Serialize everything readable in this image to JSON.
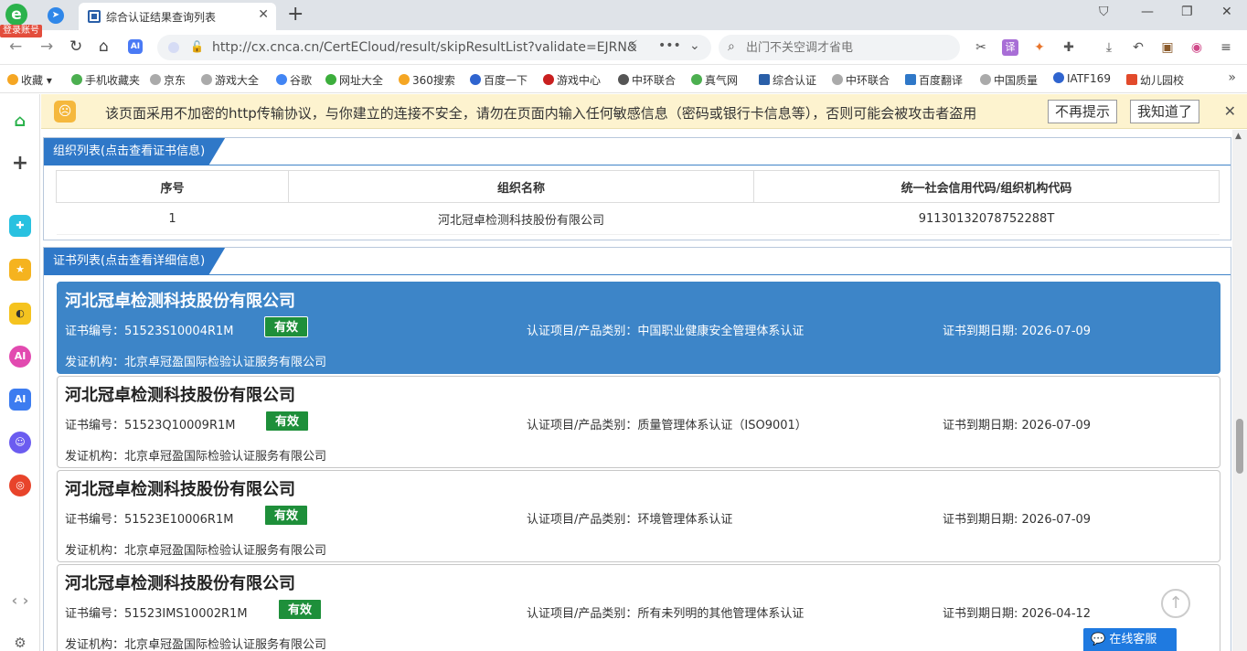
{
  "browser": {
    "login_badge": "登录账号",
    "tab_title": "综合认证结果查询列表",
    "url": "http://cx.cnca.cn/CertECloud/result/skipResultList?validate=EJRN&",
    "search_placeholder": "出门不关空调才省电"
  },
  "bookmarks": [
    {
      "label": "收藏",
      "color": "#f5a623"
    },
    {
      "label": "手机收藏夹",
      "color": "#4caf50"
    },
    {
      "label": "京东",
      "color": "#999999"
    },
    {
      "label": "游戏大全",
      "color": "#999999"
    },
    {
      "label": "谷歌",
      "color": "#4285f4"
    },
    {
      "label": "网址大全",
      "color": "#3cae3c"
    },
    {
      "label": "360搜索",
      "color": "#f5a623"
    },
    {
      "label": "百度一下",
      "color": "#2f64cf"
    },
    {
      "label": "游戏中心",
      "color": "#c91f1f"
    },
    {
      "label": "中环联合",
      "color": "#555555"
    },
    {
      "label": "真气网",
      "color": "#4caf50"
    },
    {
      "label": "综合认证",
      "color": "#2a5fa8"
    },
    {
      "label": "中环联合",
      "color": "#999999"
    },
    {
      "label": "百度翻译",
      "color": "#2f78c8"
    },
    {
      "label": "中国质量",
      "color": "#999999"
    },
    {
      "label": "IATF169",
      "color": "#2f64cf"
    },
    {
      "label": "幼儿园校",
      "color": "#e24a2b"
    }
  ],
  "warning": {
    "text": "该页面采用不加密的http传输协议，与你建立的连接不安全，请勿在页面内输入任何敏感信息（密码或银行卡信息等），否则可能会被攻击者盗用",
    "dismiss_label": "不再提示",
    "ok_label": "我知道了"
  },
  "org_panel": {
    "title": "组织列表(点击查看证书信息)",
    "headers": [
      "序号",
      "组织名称",
      "统一社会信用代码/组织机构代码"
    ],
    "rows": [
      {
        "no": "1",
        "name": "河北冠卓检测科技股份有限公司",
        "code": "91130132078752288T"
      }
    ]
  },
  "cert_panel": {
    "title": "证书列表(点击查看详细信息)",
    "certs": [
      {
        "org": "河北冠卓检测科技股份有限公司",
        "cert_no": "证书编号：51523S10004R1M",
        "status": "有效",
        "project": "认证项目/产品类别：中国职业健康安全管理体系认证",
        "expiry": "证书到期日期: 2026-07-09",
        "issuer": "发证机构：北京卓冠盈国际检验认证服务有限公司"
      },
      {
        "org": "河北冠卓检测科技股份有限公司",
        "cert_no": "证书编号：51523Q10009R1M",
        "status": "有效",
        "project": "认证项目/产品类别：质量管理体系认证（ISO9001）",
        "expiry": "证书到期日期: 2026-07-09",
        "issuer": "发证机构：北京卓冠盈国际检验认证服务有限公司"
      },
      {
        "org": "河北冠卓检测科技股份有限公司",
        "cert_no": "证书编号：51523E10006R1M",
        "status": "有效",
        "project": "认证项目/产品类别：环境管理体系认证",
        "expiry": "证书到期日期: 2026-07-09",
        "issuer": "发证机构：北京卓冠盈国际检验认证服务有限公司"
      },
      {
        "org": "河北冠卓检测科技股份有限公司",
        "cert_no": "证书编号：51523IMS10002R1M",
        "status": "有效",
        "project": "认证项目/产品类别：所有未列明的其他管理体系认证",
        "expiry": "证书到期日期: 2026-04-12",
        "issuer": "发证机构：北京卓冠盈国际检验认证服务有限公司"
      }
    ]
  },
  "service_label": "在线客服",
  "colors": {
    "accent": "#2f78c8",
    "active_card": "#3d85c8",
    "valid_badge": "#1e8f3a",
    "warning_bg": "#fdf3cf"
  }
}
